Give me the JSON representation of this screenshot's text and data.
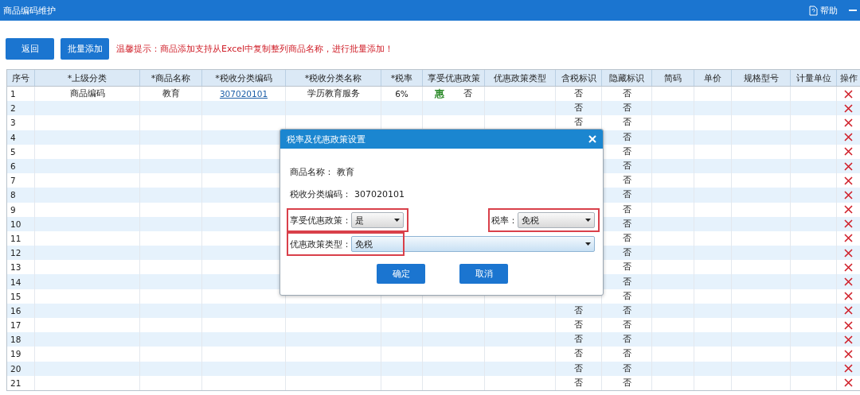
{
  "window": {
    "title": "商品编码维护",
    "help": "帮助"
  },
  "toolbar": {
    "buttons": [
      "返回",
      "批量添加"
    ],
    "tip": "温馨提示：商品添加支持从Excel中复制整列商品名称，进行批量添加！"
  },
  "table": {
    "columns": [
      "序号",
      "*上级分类",
      "*商品名称",
      "*税收分类编码",
      "*税收分类名称",
      "*税率",
      "享受优惠政策",
      "优惠政策类型",
      "含税标识",
      "隐藏标识",
      "简码",
      "单价",
      "规格型号",
      "计量单位",
      "操作"
    ],
    "rows": [
      {
        "no": "1",
        "parent": "商品编码",
        "name": "教育",
        "code": "307020101",
        "code_name": "学历教育服务",
        "rate": "6%",
        "pref_badge": "惠",
        "pref": "否",
        "tax_incl": "否",
        "hidden": "否"
      },
      {
        "no": "2",
        "tax_incl": "否",
        "hidden": "否"
      },
      {
        "no": "3",
        "tax_incl": "否",
        "hidden": "否"
      },
      {
        "no": "4",
        "hidden": "否"
      },
      {
        "no": "5",
        "hidden": "否"
      },
      {
        "no": "6",
        "hidden": "否"
      },
      {
        "no": "7",
        "hidden": "否"
      },
      {
        "no": "8",
        "hidden": "否"
      },
      {
        "no": "9",
        "hidden": "否"
      },
      {
        "no": "10",
        "hidden": "否"
      },
      {
        "no": "11",
        "hidden": "否"
      },
      {
        "no": "12",
        "hidden": "否"
      },
      {
        "no": "13",
        "hidden": "否"
      },
      {
        "no": "14",
        "hidden": "否"
      },
      {
        "no": "15",
        "hidden": "否"
      },
      {
        "no": "16",
        "tax_incl": "否",
        "hidden": "否"
      },
      {
        "no": "17",
        "tax_incl": "否",
        "hidden": "否"
      },
      {
        "no": "18",
        "tax_incl": "否",
        "hidden": "否"
      },
      {
        "no": "19",
        "tax_incl": "否",
        "hidden": "否"
      },
      {
        "no": "20",
        "tax_incl": "否",
        "hidden": "否"
      },
      {
        "no": "21",
        "tax_incl": "否",
        "hidden": "否"
      }
    ]
  },
  "dialog": {
    "title": "税率及优惠政策设置",
    "info": [
      {
        "label": "商品名称：",
        "value": "教育"
      },
      {
        "label": "税收分类编码：",
        "value": "307020101"
      }
    ],
    "selects": [
      {
        "label": "享受优惠政策：",
        "value": "是",
        "highlighted": true,
        "focused": false
      },
      {
        "label": "税率：",
        "value": "免税",
        "highlighted": true,
        "focused": false
      },
      {
        "label": "优惠政策类型：",
        "value": "免税",
        "highlighted": true,
        "focused": true
      }
    ],
    "buttons": [
      "确定",
      "取消"
    ]
  }
}
